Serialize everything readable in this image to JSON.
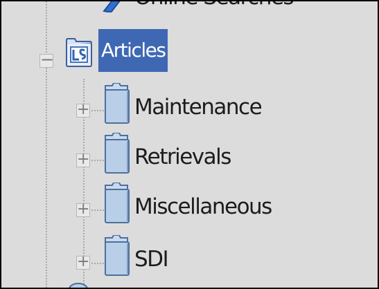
{
  "tree": {
    "top_item": {
      "label": "Online Searches"
    },
    "root": {
      "label": "Articles",
      "expander": "−",
      "icon": "library-folder-icon",
      "selected": true
    },
    "children": [
      {
        "label": "Maintenance",
        "expander": "+",
        "icon": "folder-icon"
      },
      {
        "label": "Retrievals",
        "expander": "+",
        "icon": "folder-icon"
      },
      {
        "label": "Miscellaneous",
        "expander": "+",
        "icon": "folder-icon"
      },
      {
        "label": "SDI",
        "expander": "+",
        "icon": "folder-icon"
      }
    ]
  },
  "colors": {
    "background": "#dcdcdc",
    "selection": "#3f68b4",
    "folder_fill": "#b9cfe8",
    "folder_stroke": "#4d6f9c"
  }
}
